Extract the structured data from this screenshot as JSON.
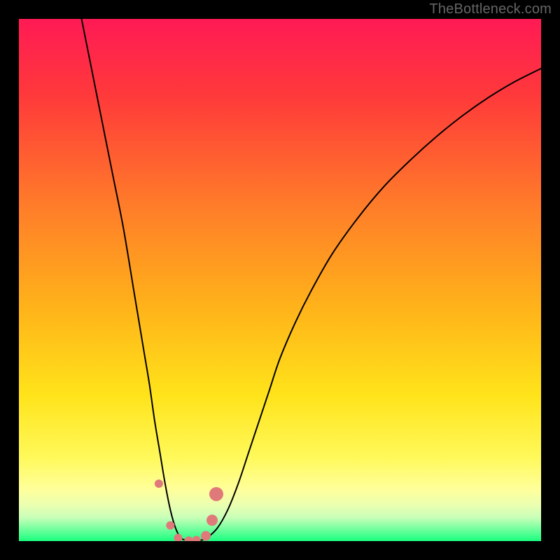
{
  "watermark": "TheBottleneck.com",
  "chart_data": {
    "type": "line",
    "title": "",
    "xlabel": "",
    "ylabel": "",
    "x_range": [
      0,
      100
    ],
    "y_range": [
      0,
      100
    ],
    "background_gradient_stops": [
      {
        "offset": 0,
        "color": "#ff1a55"
      },
      {
        "offset": 0.15,
        "color": "#ff3a3a"
      },
      {
        "offset": 0.35,
        "color": "#ff7a2a"
      },
      {
        "offset": 0.55,
        "color": "#ffb21a"
      },
      {
        "offset": 0.72,
        "color": "#ffe31a"
      },
      {
        "offset": 0.84,
        "color": "#fff95a"
      },
      {
        "offset": 0.9,
        "color": "#ffff9a"
      },
      {
        "offset": 0.93,
        "color": "#ecffb0"
      },
      {
        "offset": 0.955,
        "color": "#c8ffb8"
      },
      {
        "offset": 0.975,
        "color": "#7affa0"
      },
      {
        "offset": 1.0,
        "color": "#1aff80"
      }
    ],
    "series": [
      {
        "name": "bottleneck-curve",
        "color": "#000000",
        "stroke_width": 2,
        "x": [
          12,
          14,
          16,
          18,
          20,
          22,
          23,
          24,
          25,
          26,
          27,
          28,
          29,
          30,
          31,
          32,
          33,
          34,
          35,
          36,
          38,
          40,
          42,
          44,
          46,
          48,
          50,
          53,
          56,
          60,
          65,
          70,
          75,
          80,
          85,
          90,
          95,
          100
        ],
        "y": [
          100,
          90,
          80,
          70,
          60,
          48,
          42,
          36,
          30,
          23,
          17,
          11,
          6,
          2.5,
          0.6,
          0.2,
          0.1,
          0.1,
          0.2,
          0.6,
          2.5,
          6,
          11,
          17,
          23,
          29,
          35,
          42,
          48,
          55,
          62,
          68,
          73,
          77.5,
          81.5,
          85,
          88,
          90.5
        ]
      }
    ],
    "markers": [
      {
        "x": 26.8,
        "y": 11,
        "r": 6,
        "color": "#e07a7a"
      },
      {
        "x": 29.0,
        "y": 3.0,
        "r": 6,
        "color": "#e07a7a"
      },
      {
        "x": 30.5,
        "y": 0.6,
        "r": 6,
        "color": "#e07a7a"
      },
      {
        "x": 32.5,
        "y": 0.1,
        "r": 6,
        "color": "#e07a7a"
      },
      {
        "x": 34.0,
        "y": 0.2,
        "r": 6,
        "color": "#e07a7a"
      },
      {
        "x": 35.8,
        "y": 1.0,
        "r": 7,
        "color": "#e07a7a"
      },
      {
        "x": 37.0,
        "y": 4.0,
        "r": 8,
        "color": "#e07a7a"
      },
      {
        "x": 37.8,
        "y": 9.0,
        "r": 10,
        "color": "#e07a7a"
      }
    ]
  }
}
